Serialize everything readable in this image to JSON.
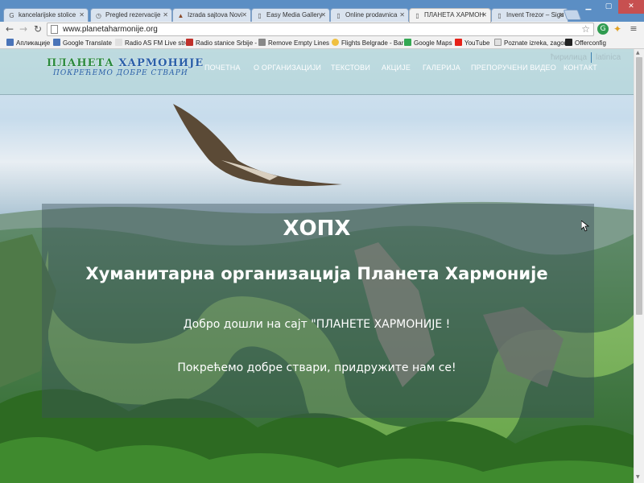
{
  "browser": {
    "tabs": [
      {
        "label": "kancelarijske stolice",
        "icon": "google-icon",
        "active": false
      },
      {
        "label": "Pregled rezervacije",
        "icon": "clock-icon",
        "active": false
      },
      {
        "label": "Izrada sajtova Novi",
        "icon": "warning-icon",
        "active": false
      },
      {
        "label": "Easy Media Gallery",
        "icon": "page-icon",
        "active": false
      },
      {
        "label": "Online prodavnica",
        "icon": "page-icon",
        "active": false
      },
      {
        "label": "ПЛАНЕТА ХАРМОН",
        "icon": "page-icon",
        "active": true
      },
      {
        "label": "Invent Trezor – Sigu",
        "icon": "page-icon",
        "active": false
      }
    ],
    "url": "www.planetaharmonije.org",
    "bookmarks": [
      {
        "label": "Апликације",
        "color": "#4a74b8"
      },
      {
        "label": "Google Translate",
        "color": "#4a74b8"
      },
      {
        "label": "Radio AS FM Live stre",
        "color": "#e0e0e0"
      },
      {
        "label": "Radio stanice Srbije -",
        "color": "#c0302a"
      },
      {
        "label": "Remove Empty Lines",
        "color": "#888888"
      },
      {
        "label": "Flights Belgrade - Bar",
        "color": "#f0c040"
      },
      {
        "label": "Google Maps",
        "color": "#34a853"
      },
      {
        "label": "YouTube",
        "color": "#e62117"
      },
      {
        "label": "Poznate izreka, zagon",
        "color": "#e0e0e0"
      },
      {
        "label": "Offerconfig",
        "color": "#222222"
      }
    ]
  },
  "site": {
    "logo_title_a": "ПЛАНЕТА ",
    "logo_title_b": "ХАРМОНИЈЕ",
    "logo_subtitle": "ПОКРЕЋЕМО ДОБРЕ СТВАРИ",
    "menu": [
      "ПОЧЕТНА",
      "О ОРГАНИЗАЦИЈИ",
      "ТЕКСТОВИ",
      "АКЦИЈЕ",
      "ГАЛЕРИЈА",
      "ПРЕПОРУЧЕНИ ВИДЕО",
      "КОНТАКТ"
    ],
    "lang_cyr": "ћирилица",
    "lang_lat": "latinica"
  },
  "hero": {
    "title": "ХОПХ",
    "subtitle": "Хуманитарна организација Планета Хармоније",
    "line1": "Добро дошли на сајт \"ПЛАНЕТЕ ХАРМОНИЈЕ !",
    "line2": "Покрећемо добре ствари, придружите нам се!"
  }
}
